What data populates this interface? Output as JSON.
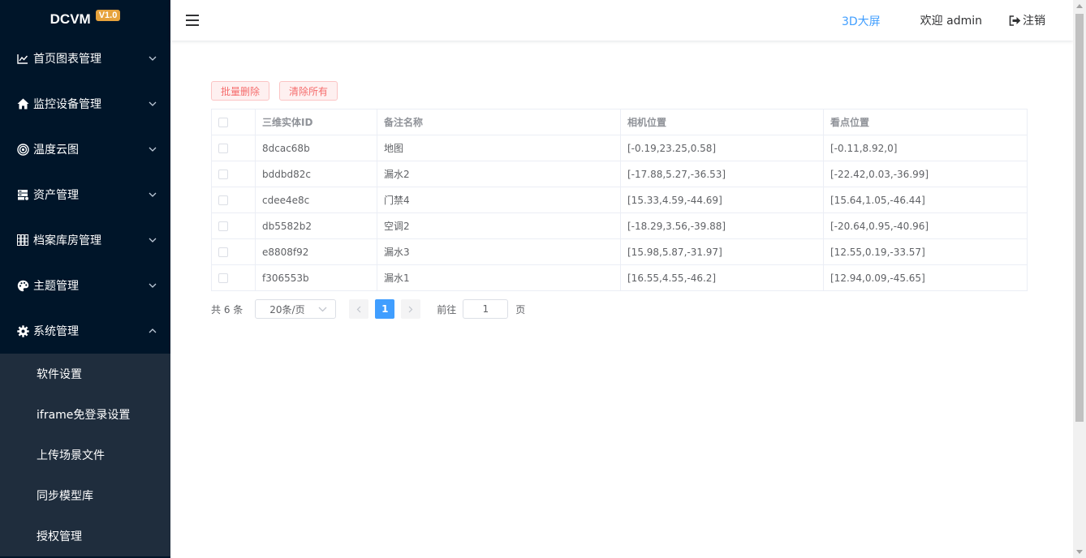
{
  "brand": {
    "name": "DCVM",
    "version": "V1.0"
  },
  "sidebar": {
    "menus": [
      {
        "label": "首页图表管理",
        "icon": "line-chart-icon",
        "expanded": false
      },
      {
        "label": "监控设备管理",
        "icon": "home-icon",
        "expanded": false
      },
      {
        "label": "温度云图",
        "icon": "target-icon",
        "expanded": false
      },
      {
        "label": "资产管理",
        "icon": "server-icon",
        "expanded": false
      },
      {
        "label": "档案库房管理",
        "icon": "archive-shelves-icon",
        "expanded": false
      },
      {
        "label": "主题管理",
        "icon": "palette-icon",
        "expanded": false
      },
      {
        "label": "系统管理",
        "icon": "gear-icon",
        "expanded": true
      }
    ],
    "submenu": [
      {
        "label": "软件设置"
      },
      {
        "label": "iframe免登录设置"
      },
      {
        "label": "上传场景文件"
      },
      {
        "label": "同步模型库"
      },
      {
        "label": "授权管理"
      }
    ]
  },
  "header": {
    "link_3d": "3D大屏",
    "welcome": "欢迎 admin",
    "logout": "注销"
  },
  "toolbar": {
    "batch_delete": "批量删除",
    "clear_all": "清除所有"
  },
  "table": {
    "columns": [
      "三维实体ID",
      "备注名称",
      "相机位置",
      "看点位置"
    ],
    "rows": [
      {
        "id": "8dcac68b",
        "name": "地图",
        "camera": "[-0.19,23.25,0.58]",
        "look": "[-0.11,8.92,0]"
      },
      {
        "id": "bddbd82c",
        "name": "漏水2",
        "camera": "[-17.88,5.27,-36.53]",
        "look": "[-22.42,0.03,-36.99]"
      },
      {
        "id": "cdee4e8c",
        "name": "门禁4",
        "camera": "[15.33,4.59,-44.69]",
        "look": "[15.64,1.05,-46.44]"
      },
      {
        "id": "db5582b2",
        "name": "空调2",
        "camera": "[-18.29,3.56,-39.88]",
        "look": "[-20.64,0.95,-40.96]"
      },
      {
        "id": "e8808f92",
        "name": "漏水3",
        "camera": "[15.98,5.87,-31.97]",
        "look": "[12.55,0.19,-33.57]"
      },
      {
        "id": "f306553b",
        "name": "漏水1",
        "camera": "[16.55,4.55,-46.2]",
        "look": "[12.94,0.09,-45.65]"
      }
    ]
  },
  "pagination": {
    "total": "共 6 条",
    "page_size": "20条/页",
    "current_page": "1",
    "goto_label": "前往",
    "goto_value": "1",
    "page_suffix": "页"
  },
  "colors": {
    "sidebar_bg": "#001529",
    "submenu_bg": "#1f2d3d",
    "accent": "#409eff",
    "danger": "#f56c6c",
    "version_badge": "#e6a23c"
  }
}
